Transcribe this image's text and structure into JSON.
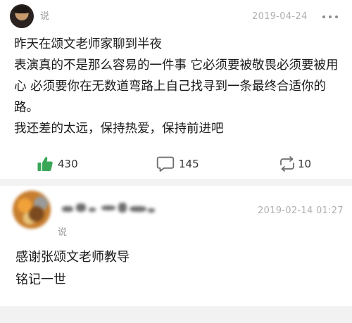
{
  "post": {
    "author_suffix": "说",
    "date": "2019-04-24",
    "paragraphs": [
      "昨天在颂文老师家聊到半夜",
      "表演真的不是那么容易的一件事 它必须要被敬畏必须要被用心 必须要你在无数道弯路上自己找寻到一条最终合适你的路。",
      "我还差的太远，保持热爱，保持前进吧"
    ],
    "actions": {
      "like_count": "430",
      "comment_count": "145",
      "repost_count": "10"
    },
    "colors": {
      "like_green": "#3aa757",
      "icon_gray": "#6b6b6b"
    },
    "icons": {
      "like": "thumbs-up-icon",
      "comment": "speech-bubble-icon",
      "repost": "repost-arrows-icon",
      "more": "more-dots-icon"
    }
  },
  "comment": {
    "author_suffix": "说",
    "date": "2019-02-14 01:27",
    "lines": [
      "感谢张颂文老师教导",
      "铭记一世"
    ]
  }
}
